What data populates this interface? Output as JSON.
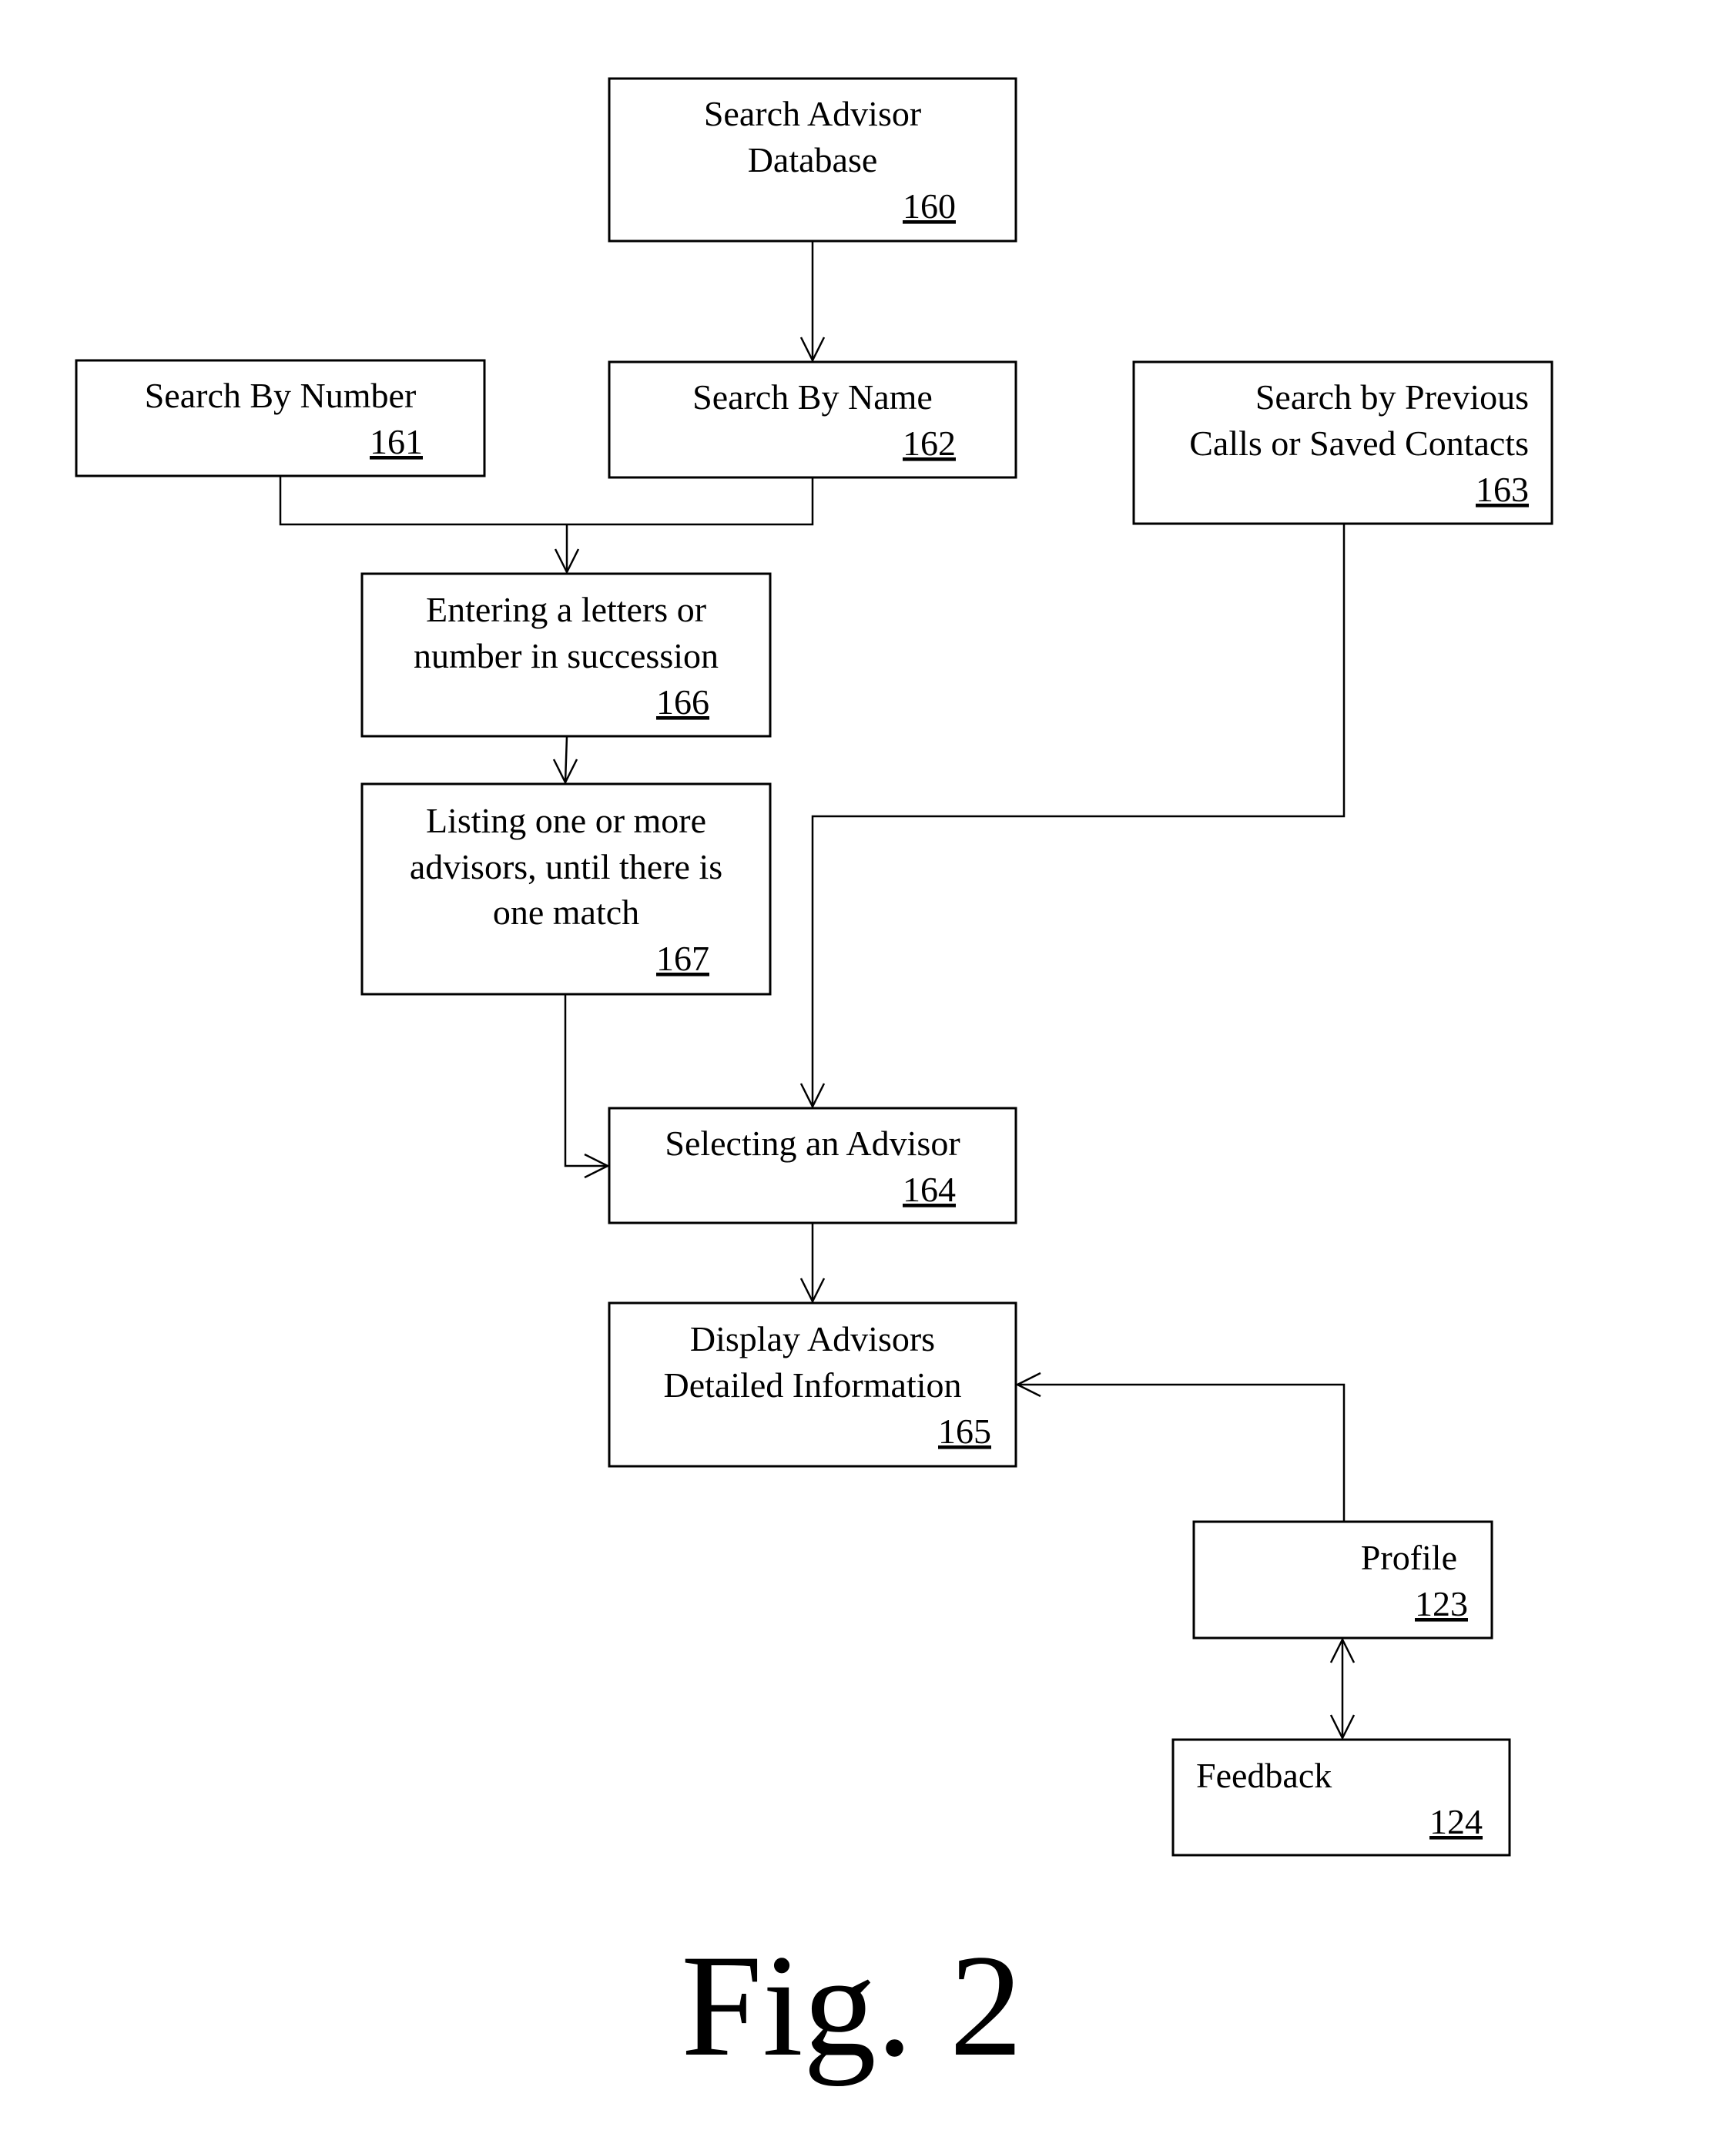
{
  "figure": {
    "caption": "Fig. 2",
    "line_color": "#000000",
    "background": "#ffffff"
  },
  "boxes": {
    "b160": {
      "lines": [
        "Search Advisor",
        "Database"
      ],
      "ref": "160"
    },
    "b161": {
      "lines": [
        "Search By Number"
      ],
      "ref": "161"
    },
    "b162": {
      "lines": [
        "Search By Name"
      ],
      "ref": "162"
    },
    "b163": {
      "lines": [
        "Search by Previous",
        "Calls or Saved Contacts"
      ],
      "ref": "163"
    },
    "b166": {
      "lines": [
        "Entering a letters or",
        "number in succession"
      ],
      "ref": "166"
    },
    "b167": {
      "lines": [
        "Listing one or more",
        "advisors, until there is",
        "one match"
      ],
      "ref": "167"
    },
    "b164": {
      "lines": [
        "Selecting an Advisor"
      ],
      "ref": "164"
    },
    "b165": {
      "lines": [
        "Display Advisors",
        "Detailed Information"
      ],
      "ref": "165"
    },
    "b123": {
      "lines": [
        "Profile"
      ],
      "ref": "123"
    },
    "b124": {
      "lines": [
        "Feedback"
      ],
      "ref": "124"
    }
  },
  "connections": [
    {
      "from": "160",
      "to": "162",
      "type": "arrow"
    },
    {
      "from": "161",
      "to": "166",
      "type": "arrow"
    },
    {
      "from": "162",
      "to": "166",
      "type": "arrow"
    },
    {
      "from": "166",
      "to": "167",
      "type": "arrow"
    },
    {
      "from": "167",
      "to": "164",
      "type": "arrow"
    },
    {
      "from": "163",
      "to": "164",
      "type": "arrow"
    },
    {
      "from": "164",
      "to": "165",
      "type": "arrow"
    },
    {
      "from": "123",
      "to": "165",
      "type": "arrow"
    },
    {
      "from": "123",
      "to": "124",
      "type": "bidirectional"
    }
  ]
}
